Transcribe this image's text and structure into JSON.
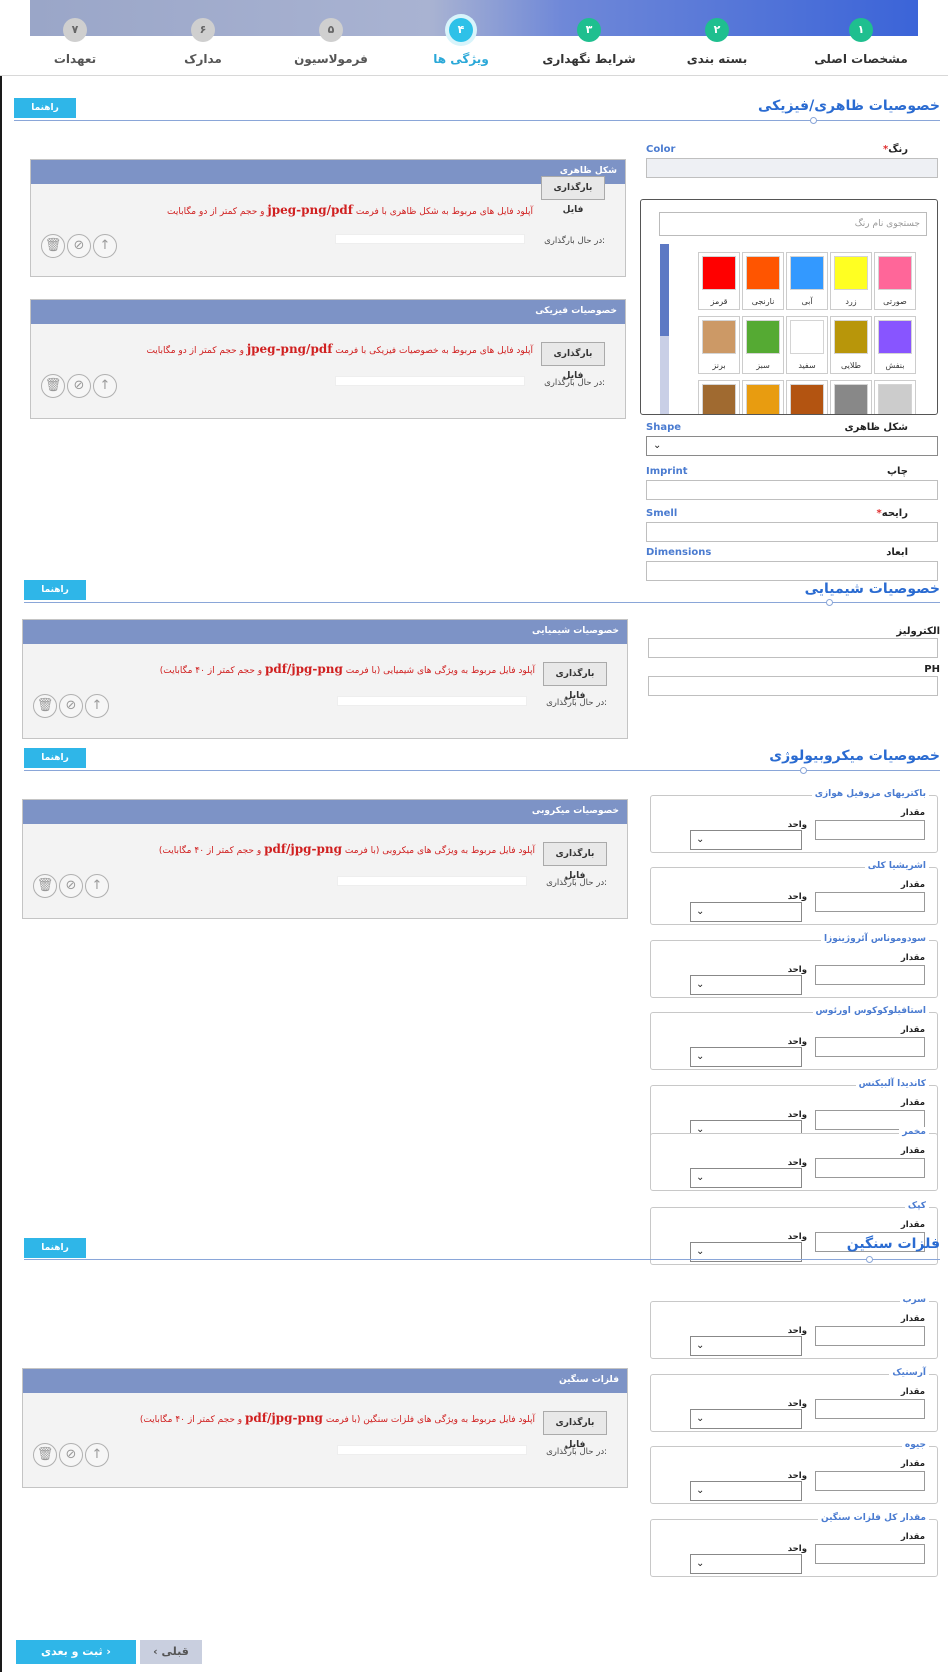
{
  "steps": [
    {
      "num": "۷",
      "label": "تعهدات"
    },
    {
      "num": "۶",
      "label": "مدارک"
    },
    {
      "num": "۵",
      "label": "فرمولاسیون"
    },
    {
      "num": "۴",
      "label": "ویژگی ها"
    },
    {
      "num": "۳",
      "label": "شرایط نگهداری"
    },
    {
      "num": "۲",
      "label": "بسته بندی"
    },
    {
      "num": "۱",
      "label": "مشخصات اصلی"
    }
  ],
  "guide_label": "راهنما",
  "physical": {
    "title": "خصوصیات ظاهری/فیزیکی",
    "color_label": "رنگ",
    "color_en": "Color",
    "required_mark": "*",
    "search_placeholder": "جستجوی نام رنگ",
    "swatches": [
      {
        "name": "صورتی",
        "hex": "#ff6699"
      },
      {
        "name": "زرد",
        "hex": "#ffff22"
      },
      {
        "name": "آبی",
        "hex": "#3399ff"
      },
      {
        "name": "نارنجی",
        "hex": "#ff5500"
      },
      {
        "name": "قرمز",
        "hex": "#ff0000"
      },
      {
        "name": "بنفش",
        "hex": "#8855ff"
      },
      {
        "name": "طلایی",
        "hex": "#b8960a"
      },
      {
        "name": "سفید",
        "hex": "#ffffff"
      },
      {
        "name": "سبز",
        "hex": "#55aa33"
      },
      {
        "name": "برنز",
        "hex": "#cc9966"
      }
    ],
    "swatch_row3": [
      "#cccccc",
      "#888888",
      "#b35411",
      "#e89c10",
      "#a06a30"
    ],
    "shape_label": "شکل ظاهری",
    "shape_en": "Shape",
    "imprint_label": "چاپ",
    "imprint_en": "Imprint",
    "smell_label": "رایحه",
    "smell_en": "Smell",
    "dims_label": "ابعاد",
    "dims_en": "Dimensions"
  },
  "upload": {
    "button": "بارگذاری فایل",
    "loading": "در حال بارگذاری:",
    "icons": [
      "trash-icon",
      "cancel-icon",
      "upload-icon"
    ]
  },
  "panels": [
    {
      "title": "شکل ظاهری",
      "note_pre": "آپلود فایل های مربوط به شکل ظاهری با فرمت ",
      "note_em": "jpeg-png/pdf",
      "note_post": " و حجم کمتر از دو مگابایت"
    },
    {
      "title": "خصوصیات فیزیکی",
      "note_pre": "آپلود فایل های مربوط به خصوصیات فیزیکی با فرمت ",
      "note_em": "jpeg-png/pdf",
      "note_post": " و حجم کمتر از دو مگابایت"
    },
    {
      "title": "خصوصیات شیمیایی",
      "note_pre": "آپلود فایل مربوط به ویژگی های شیمیایی (با فرمت ",
      "note_em": "pdf/jpg-png",
      "note_post": " و حجم کمتر از ۴۰ مگابایت)"
    },
    {
      "title": "خصوصیات میکروبی",
      "note_pre": "آپلود فایل مربوط به ویژگی های میکروبی (با فرمت ",
      "note_em": "pdf/jpg-png",
      "note_post": " و حجم کمتر از ۴۰ مگابایت)"
    },
    {
      "title": "فلزات سنگین",
      "note_pre": "آپلود فایل مربوط به ویژگی های فلزات سنگین (با فرمت ",
      "note_em": "pdf/jpg-png",
      "note_post": " و حجم کمتر از ۴۰ مگابایت)"
    }
  ],
  "chemical": {
    "title": "خصوصیات شیمیایی",
    "electrolyte": "الکترولیز",
    "ph": "PH"
  },
  "micro": {
    "title": "خصوصیات میکروبیولوژی",
    "amount": "مقدار",
    "unit": "واحد",
    "groups": [
      "باکتریهای مزوفیل هوازی",
      "اشریشیا کلی",
      "سودوموناس آئروژینوزا",
      "استافیلوکوکوس اورئوس",
      "کاندیدا آلبیکنس",
      "مخمر",
      "کپک"
    ]
  },
  "metals": {
    "title": "فلزات سنگین",
    "groups": [
      "سرب",
      "آرسنیک",
      "جیوه",
      "مقدار کل فلزات سنگین"
    ]
  },
  "footer": {
    "prev": "‹ قبلی",
    "next": "ثبت و بعدی ›"
  }
}
